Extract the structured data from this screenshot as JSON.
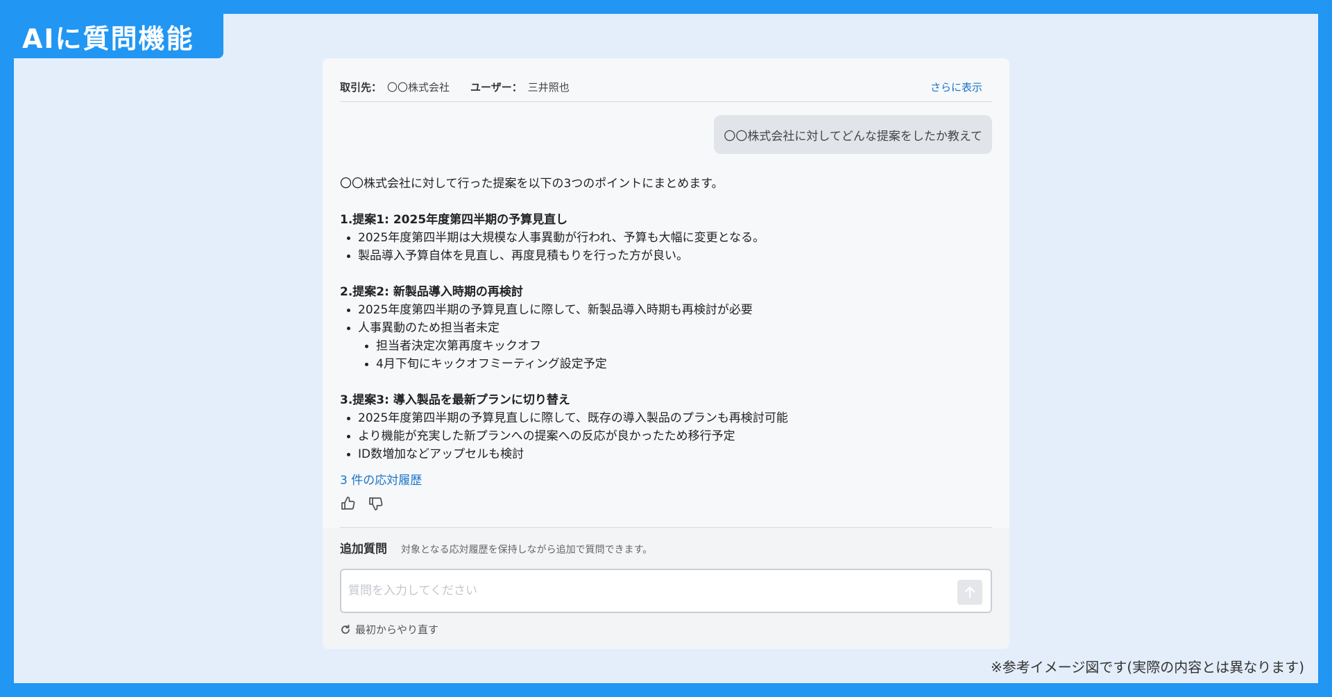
{
  "header": {
    "title": "AIに質問機能"
  },
  "info": {
    "client_label": "取引先：",
    "client_value": "〇〇株式会社",
    "user_label": "ユーザー：",
    "user_value": "三井照也",
    "more_link": "さらに表示"
  },
  "user_message": "〇〇株式会社に対してどんな提案をしたか教えて",
  "answer": {
    "intro": "〇〇株式会社に対して行った提案を以下の3つのポイントにまとめます。",
    "sections": [
      {
        "heading": "1.提案1: 2025年度第四半期の予算見直し",
        "items": [
          "2025年度第四半期は大規模な人事異動が行われ、予算も大幅に変更となる。",
          "製品導入予算自体を見直し、再度見積もりを行った方が良い。"
        ]
      },
      {
        "heading": "2.提案2: 新製品導入時期の再検討",
        "items": [
          "2025年度第四半期の予算見直しに際して、新製品導入時期も再検討が必要",
          "人事異動のため担当者未定"
        ],
        "sub_items": [
          "担当者決定次第再度キックオフ",
          "4月下旬にキックオフミーティング設定予定"
        ]
      },
      {
        "heading": "3.提案3: 導入製品を最新プランに切り替え",
        "items": [
          "2025年度第四半期の予算見直しに際して、既存の導入製品のプランも再検討可能",
          "より機能が充実した新プランへの提案への反応が良かったため移行予定",
          "ID数増加などアップセルも検討"
        ]
      }
    ]
  },
  "history_link": "3 件の応対履歴",
  "feedback": {
    "like_icon": "thumbs-up-icon",
    "dislike_icon": "thumbs-down-icon"
  },
  "followup": {
    "title": "追加質問",
    "note": "対象となる応対履歴を保持しながら追加で質問できます。",
    "placeholder": "質問を入力してください",
    "value": "",
    "restart_label": "最初からやり直す"
  },
  "disclaimer": "※参考イメージ図です(実際の内容とは異なります)",
  "colors": {
    "frame_blue": "#2196f3",
    "background": "#e3eefa",
    "link": "#1a73c8"
  }
}
